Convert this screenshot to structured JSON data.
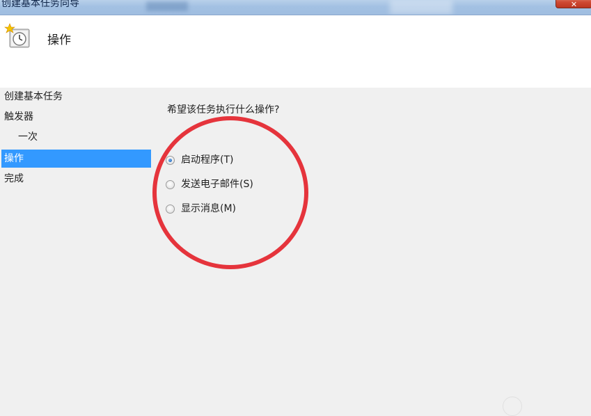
{
  "window": {
    "title": "创建基本任务向导",
    "close_label": "✕"
  },
  "header": {
    "title": "操作",
    "icon": "task-clock-icon"
  },
  "nav": {
    "items": [
      {
        "label": "创建基本任务"
      },
      {
        "label": "触发器"
      },
      {
        "label": "一次"
      },
      {
        "label": "操作"
      },
      {
        "label": "完成"
      }
    ],
    "selected": "操作"
  },
  "content": {
    "question": "希望该任务执行什么操作?",
    "options": [
      {
        "label": "启动程序(T)",
        "checked": true
      },
      {
        "label": "发送电子邮件(S)",
        "checked": false
      },
      {
        "label": "显示消息(M)",
        "checked": false
      }
    ]
  },
  "colors": {
    "selection": "#3399ff",
    "annotation_circle": "#e5343c",
    "header_bg": "#ffffff",
    "body_bg": "#f0f0f0"
  }
}
